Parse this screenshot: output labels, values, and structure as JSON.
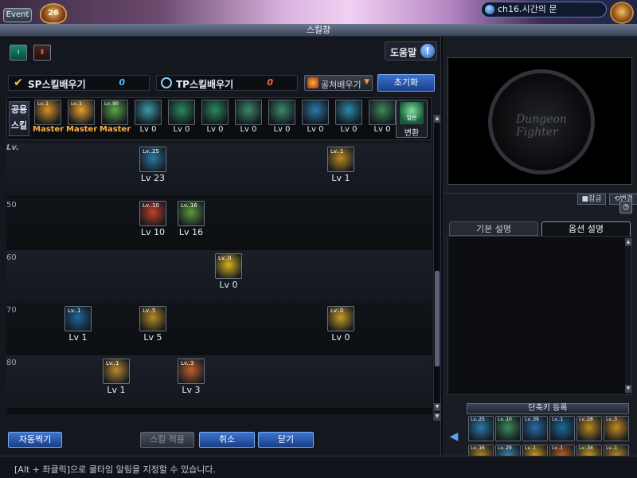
{
  "hud": {
    "event_label": "Event",
    "level_text": "26",
    "channel_text": "ch16.시간의 문"
  },
  "window": {
    "title": "스킬창"
  },
  "skill_tabs": [
    "Ⅰ",
    "Ⅱ"
  ],
  "help": {
    "label": "도움말",
    "icon_glyph": "!"
  },
  "learn": {
    "sp_label": "SP스킬배우기",
    "sp_value": "0",
    "tp_label": "TP스킬배우기",
    "tp_value": "0",
    "select_label": "골쳐배우기",
    "reset_label": "초기화"
  },
  "common_skills": {
    "label": "공용 스킬",
    "items": [
      {
        "tag": "Lv..1",
        "level": "Master",
        "color": "#d8902c"
      },
      {
        "tag": "Lv..1",
        "level": "Master",
        "color": "#e8a030"
      },
      {
        "tag": "Lv..90",
        "level": "Master",
        "color": "#58a848"
      },
      {
        "tag": "",
        "level": "Lv 0",
        "color": "#3a9aaa"
      },
      {
        "tag": "",
        "level": "Lv 0",
        "color": "#2a8a5a"
      },
      {
        "tag": "",
        "level": "Lv 0",
        "color": "#2a8a5a"
      },
      {
        "tag": "",
        "level": "Lv 0",
        "color": "#3a8a6a"
      },
      {
        "tag": "",
        "level": "Lv 0",
        "color": "#3a8a6a"
      },
      {
        "tag": "",
        "level": "Lv 0",
        "color": "#2a7aaa"
      },
      {
        "tag": "",
        "level": "Lv 0",
        "color": "#2a8aaa"
      },
      {
        "tag": "",
        "level": "Lv 0",
        "color": "#3a8a5a"
      }
    ],
    "convert_icon_text": "일반",
    "convert_label": "변환"
  },
  "tree": {
    "lv_header": "Lv.",
    "bands": [
      {
        "label": ""
      },
      {
        "label": "50"
      },
      {
        "label": "60"
      },
      {
        "label": "70"
      },
      {
        "label": "80"
      }
    ],
    "skills": [
      {
        "tag": "Lv..25",
        "level": "Lv 23",
        "color": "#2a7aa8"
      },
      {
        "tag": "Lv..1",
        "level": "Lv 1",
        "color": "#b88a20"
      },
      {
        "tag": "Lv..10",
        "level": "Lv 10",
        "color": "#c0402a"
      },
      {
        "tag": "Lv..16",
        "level": "Lv 16",
        "color": "#5a9a3a"
      },
      {
        "tag": "Lv..0",
        "level": "Lv 0",
        "color": "#d8b020"
      },
      {
        "tag": "Lv..1",
        "level": "Lv 1",
        "color": "#1a6a9a"
      },
      {
        "tag": "Lv..5",
        "level": "Lv 5",
        "color": "#b88a20"
      },
      {
        "tag": "Lv..0",
        "level": "Lv 0",
        "color": "#c89a20"
      },
      {
        "tag": "Lv..1",
        "level": "Lv 1",
        "color": "#b88a30"
      },
      {
        "tag": "Lv..3",
        "level": "Lv 3",
        "color": "#c0602a"
      }
    ]
  },
  "buttons": {
    "auto": "자동찍기",
    "apply": "스킬 적용",
    "cancel": "취소",
    "close": "닫기"
  },
  "tip": "[Alt + 좌클릭]으로 쿨타임 알림을 지정할 수 있습니다.",
  "right": {
    "logo_text": "Dungeon Fighter",
    "lock_label": "잠금",
    "change_label": "변경",
    "tab_basic": "기본 설명",
    "tab_option": "옵션 설명",
    "shortcut_label": "단축키 등록",
    "shortcuts": [
      {
        "tag": "Lv..25",
        "color": "#2a7aa8"
      },
      {
        "tag": "Lv..10",
        "color": "#3a8a5a"
      },
      {
        "tag": "Lv..39",
        "color": "#2a6aa8"
      },
      {
        "tag": "Lv..1",
        "color": "#1a6a9a"
      },
      {
        "tag": "Lv..28",
        "color": "#b88a20"
      },
      {
        "tag": "Lv..3",
        "color": "#c08a20"
      },
      {
        "tag": "Lv..16",
        "color": "#b88a20"
      },
      {
        "tag": "Lv..29",
        "color": "#3a8aaa"
      },
      {
        "tag": "Lv..1",
        "color": "#d0a020"
      },
      {
        "tag": "Lv..1",
        "color": "#c0602a"
      },
      {
        "tag": "Lv..34",
        "color": "#c8a020"
      },
      {
        "tag": "Lv..1",
        "color": "#b8902a"
      }
    ]
  },
  "icons": {
    "check": "✔",
    "arrow_down": "▼",
    "arrow_up": "▲",
    "arrow_left": "◀",
    "clock": "◷",
    "lock": "🔒"
  }
}
